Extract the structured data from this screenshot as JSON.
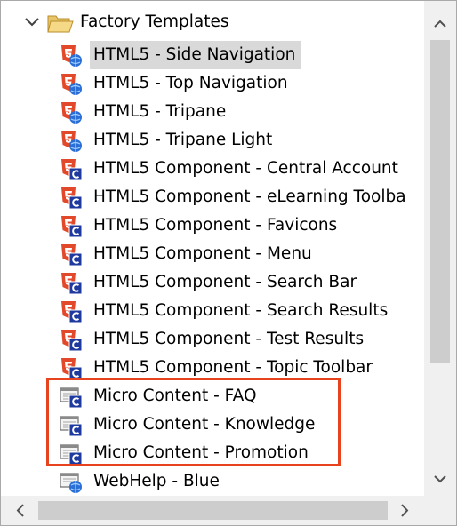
{
  "tree": {
    "root": {
      "label": "Factory Templates",
      "expanded": true,
      "icon": "folder-open-icon"
    },
    "items": [
      {
        "label": "HTML5 - Side Navigation",
        "icon": "html5-skin-icon",
        "selected": true
      },
      {
        "label": "HTML5 - Top Navigation",
        "icon": "html5-skin-icon"
      },
      {
        "label": "HTML5 - Tripane",
        "icon": "html5-skin-icon"
      },
      {
        "label": "HTML5 - Tripane Light",
        "icon": "html5-skin-icon"
      },
      {
        "label": "HTML5 Component - Central Account",
        "icon": "html5-component-icon"
      },
      {
        "label": "HTML5 Component - eLearning Toolba",
        "icon": "html5-component-icon"
      },
      {
        "label": "HTML5 Component - Favicons",
        "icon": "html5-component-icon"
      },
      {
        "label": "HTML5 Component - Menu",
        "icon": "html5-component-icon"
      },
      {
        "label": "HTML5 Component - Search Bar",
        "icon": "html5-component-icon"
      },
      {
        "label": "HTML5 Component - Search Results",
        "icon": "html5-component-icon"
      },
      {
        "label": "HTML5 Component - Test Results",
        "icon": "html5-component-icon"
      },
      {
        "label": "HTML5 Component - Topic Toolbar",
        "icon": "html5-component-icon"
      },
      {
        "label": "Micro Content - FAQ",
        "icon": "micro-content-component-icon"
      },
      {
        "label": "Micro Content - Knowledge",
        "icon": "micro-content-component-icon"
      },
      {
        "label": "Micro Content - Promotion",
        "icon": "micro-content-component-icon"
      },
      {
        "label": "WebHelp - Blue",
        "icon": "webhelp-skin-icon"
      }
    ]
  },
  "colors": {
    "html5_orange": "#e2492a",
    "component_blue": "#1f3a9e",
    "highlight_border": "#e8431f",
    "selection": "#d9d9d9",
    "scrollbar_track": "#f0f0f0",
    "scrollbar_thumb": "#cdcdcd"
  }
}
